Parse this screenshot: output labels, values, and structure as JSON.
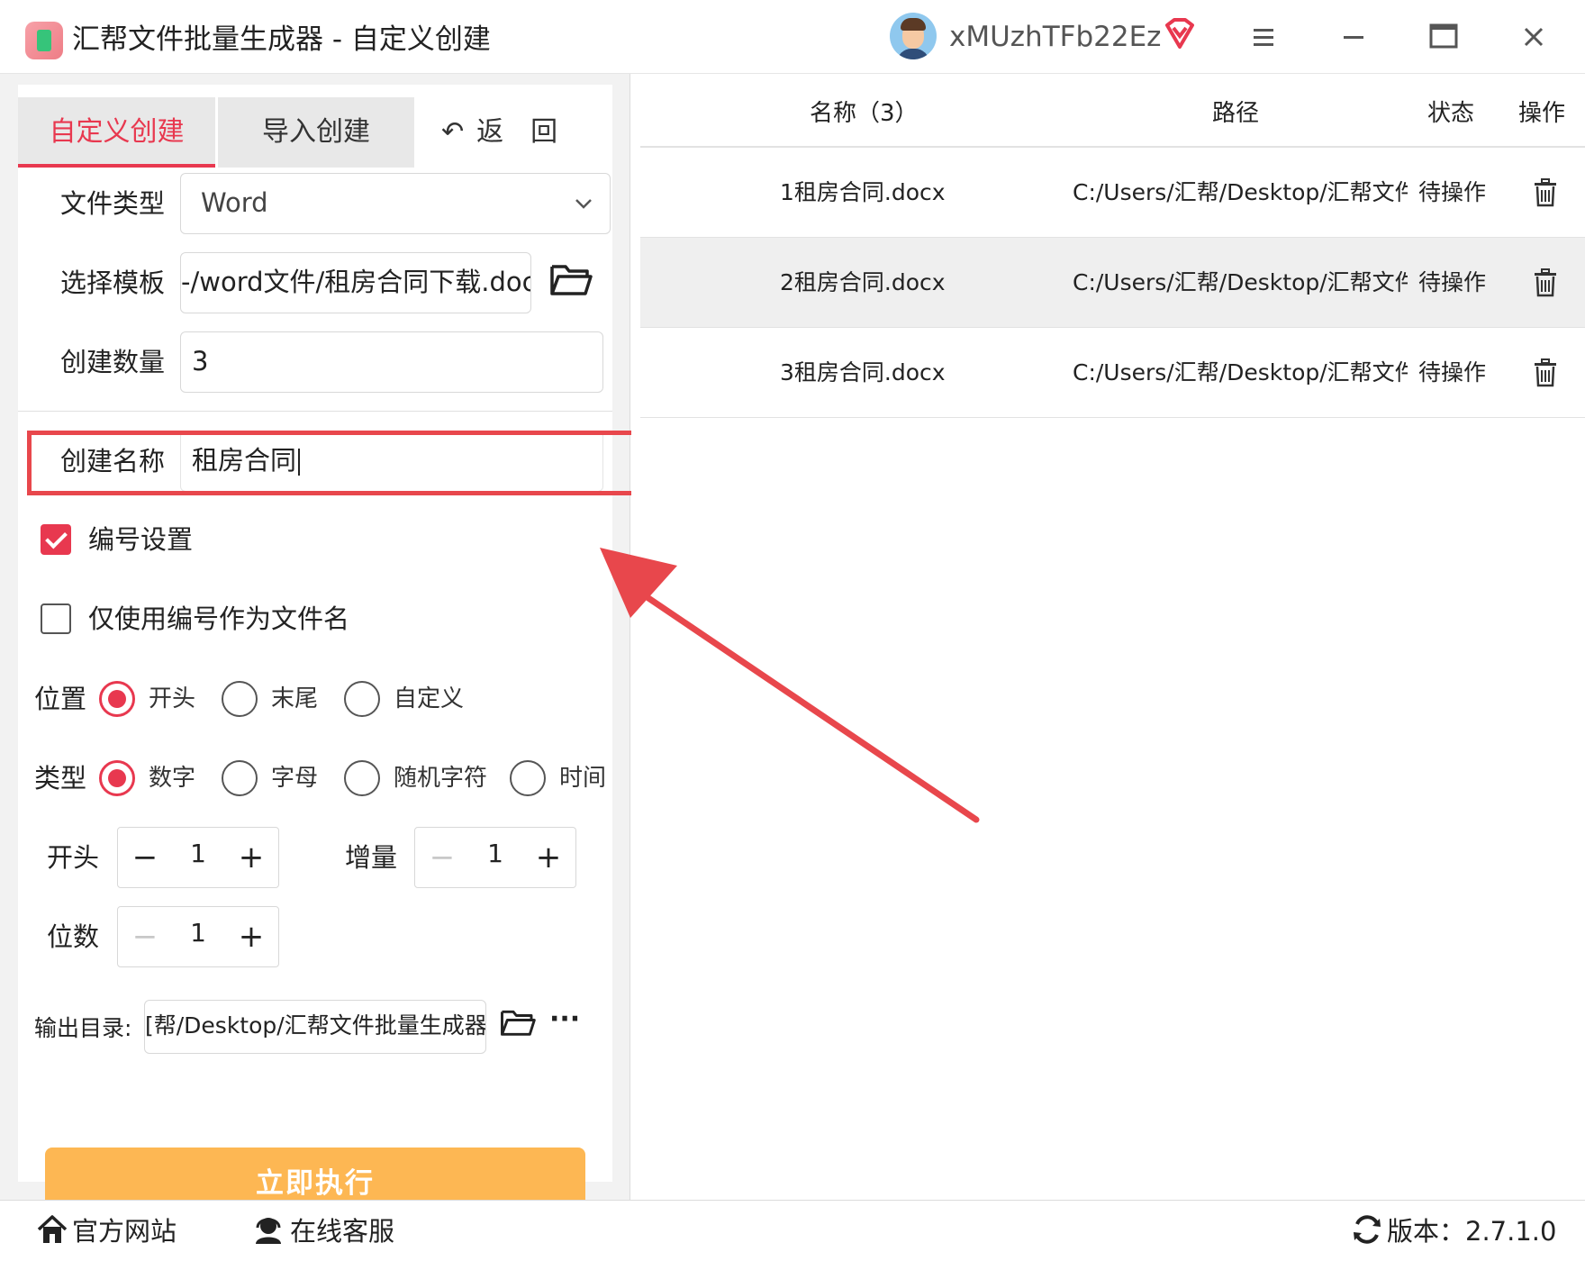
{
  "window": {
    "title": "汇帮文件批量生成器 - 自定义创建",
    "username": "xMUzhTFb22Ez"
  },
  "tabs": {
    "custom": "自定义创建",
    "import": "导入创建",
    "back": "返　回"
  },
  "form": {
    "file_type_label": "文件类型",
    "file_type_value": "Word",
    "template_label": "选择模板",
    "template_value": "-/word文件/租房合同下载.doc",
    "count_label": "创建数量",
    "count_value": "3",
    "name_label": "创建名称",
    "name_value": "租房合同",
    "numbering_label": "编号设置",
    "numbering_checked": true,
    "only_number_label": "仅使用编号作为文件名",
    "only_number_checked": false,
    "position_label": "位置",
    "position_options": [
      "开头",
      "末尾",
      "自定义"
    ],
    "position_selected": "开头",
    "type_label": "类型",
    "type_options": [
      "数字",
      "字母",
      "随机字符",
      "时间"
    ],
    "type_selected": "数字",
    "start_label": "开头",
    "start_value": "1",
    "increment_label": "增量",
    "increment_value": "1",
    "digits_label": "位数",
    "digits_value": "1",
    "output_label": "输出目录:",
    "output_value": "[帮/Desktop/汇帮文件批量生成器",
    "more_label": "···",
    "run_label": "立即执行"
  },
  "table": {
    "headers": {
      "name": "名称（3）",
      "path": "路径",
      "status": "状态",
      "action": "操作"
    },
    "rows": [
      {
        "name": "1租房合同.docx",
        "path": "C:/Users/汇帮/Desktop/汇帮文件",
        "status": "待操作"
      },
      {
        "name": "2租房合同.docx",
        "path": "C:/Users/汇帮/Desktop/汇帮文件",
        "status": "待操作"
      },
      {
        "name": "3租房合同.docx",
        "path": "C:/Users/汇帮/Desktop/汇帮文件",
        "status": "待操作"
      }
    ]
  },
  "footer": {
    "website": "官方网站",
    "service": "在线客服",
    "version": "版本：2.7.1.0"
  },
  "colors": {
    "accent": "#e8384f",
    "button": "#fdb753",
    "highlight": "#e8474c"
  },
  "icons": [
    "app-icon",
    "vip-icon",
    "menu-icon",
    "minimize-icon",
    "maximize-icon",
    "close-icon",
    "chevron-down-icon",
    "folder-icon",
    "trash-icon",
    "home-icon",
    "headset-icon",
    "refresh-icon",
    "back-arrow-icon"
  ]
}
